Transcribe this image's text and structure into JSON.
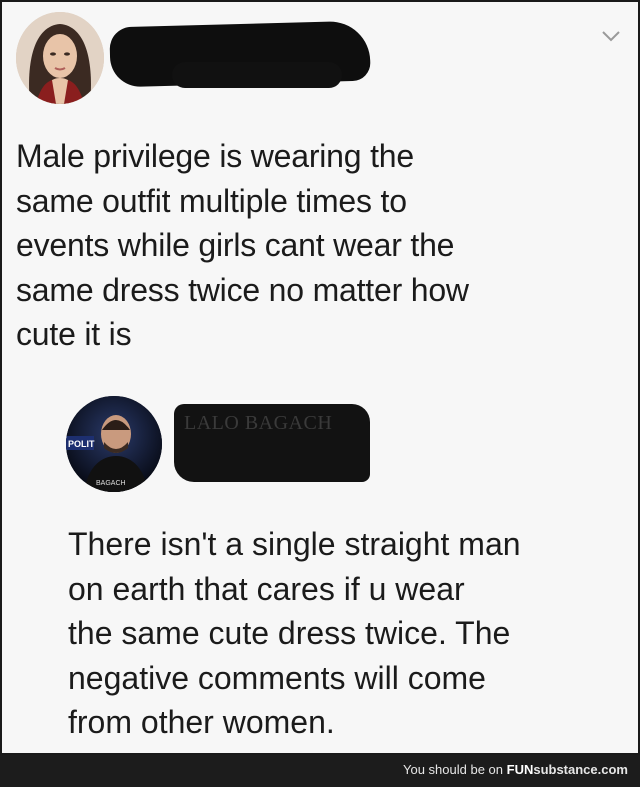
{
  "post": {
    "text": "Male privilege is wearing the\nsame outfit multiple times to\nevents while girls cant wear the\nsame dress twice  no matter how\ncute it is"
  },
  "reply": {
    "avatar_caption_left": "POLIT",
    "avatar_caption_bottom": "BAGACH",
    "ghost_name": "LALO BAGACH",
    "text": "There isn't a single straight man\non earth that cares if u wear\nthe same cute dress twice. The\nnegative comments will come\nfrom other women."
  },
  "footer": {
    "prefix": "You should be on ",
    "brand_bold": "FUN",
    "brand_rest": "substance.com"
  },
  "icons": {
    "chevron": "chevron-down-icon"
  },
  "colors": {
    "text": "#1b1b1b",
    "redaction": "#0e0e0e",
    "footer_bg": "#1c1c1c"
  }
}
